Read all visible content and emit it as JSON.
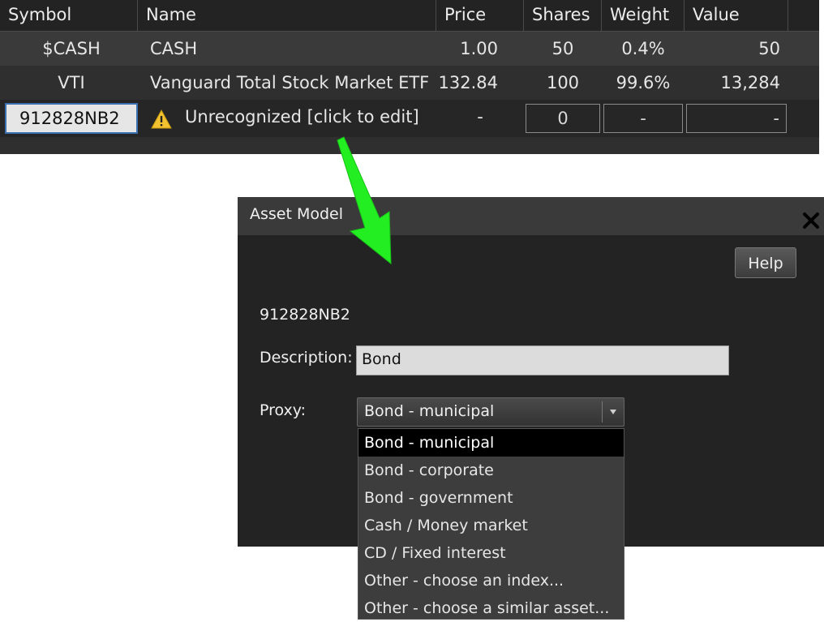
{
  "table": {
    "columns": [
      "Symbol",
      "Name",
      "Price",
      "Shares",
      "Weight",
      "Value"
    ],
    "rows": [
      {
        "symbol": "$CASH",
        "name": "CASH",
        "price": "1.00",
        "shares": "50",
        "weight": "0.4%",
        "value": "50"
      },
      {
        "symbol": "VTI",
        "name": "Vanguard Total Stock Market ETF",
        "price": "132.84",
        "shares": "100",
        "weight": "99.6%",
        "value": "13,284"
      }
    ],
    "edit_row": {
      "symbol_value": "912828NB2",
      "name": "Unrecognized [click to edit]",
      "price": "-",
      "shares": "0",
      "weight": "-",
      "value": "-"
    }
  },
  "dialog": {
    "title": "Asset Model",
    "help_label": "Help",
    "asset_symbol": "912828NB2",
    "description_label": "Description:",
    "description_value": "Bond",
    "proxy_label": "Proxy:",
    "proxy_selected": "Bond - municipal"
  },
  "dropdown": {
    "options": [
      "Bond - municipal",
      "Bond - corporate",
      "Bond - government",
      "Cash / Money market",
      "CD / Fixed interest",
      "Other - choose an index...",
      "Other - choose a similar asset..."
    ],
    "selected_index": 0
  },
  "colors": {
    "arrow": "#22ee22",
    "warning": "#f2c230",
    "selected_option_bg": "#000000"
  },
  "icons": [
    "warning-icon",
    "close-icon",
    "chevron-down-icon"
  ]
}
